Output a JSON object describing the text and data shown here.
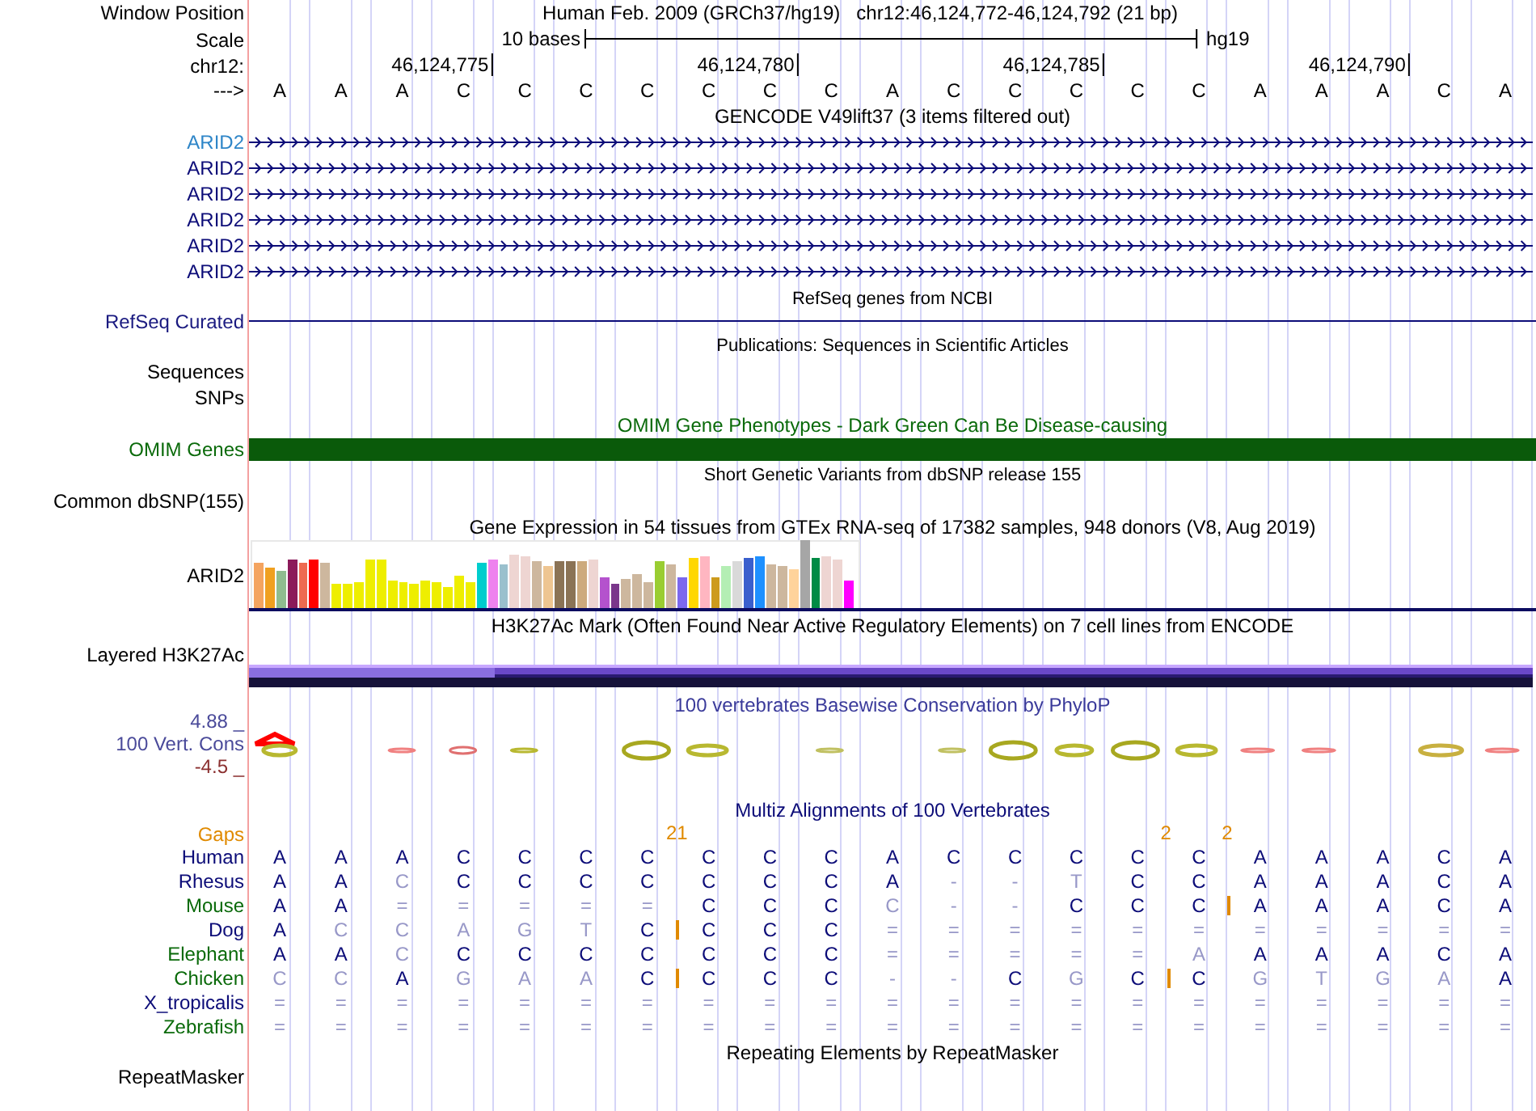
{
  "position": {
    "label": "Window Position",
    "assembly": "Human Feb. 2009 (GRCh37/hg19)",
    "range": "chr12:46,124,772-46,124,792 (21 bp)"
  },
  "scale": {
    "label": "Scale",
    "span": "10 bases",
    "assembly": "hg19"
  },
  "ruler": {
    "label": "chr12:",
    "ticks": [
      "46,124,775",
      "46,124,780",
      "46,124,785",
      "46,124,790"
    ]
  },
  "sequence": {
    "label": "--->",
    "bases": [
      "A",
      "A",
      "A",
      "C",
      "C",
      "C",
      "C",
      "C",
      "C",
      "C",
      "A",
      "C",
      "C",
      "C",
      "C",
      "C",
      "A",
      "A",
      "A",
      "C",
      "A"
    ]
  },
  "tracks": [
    {
      "kind": "gene",
      "title": "GENCODE V49lift37 (3 items filtered out)",
      "items": [
        {
          "name": "ARID2",
          "color": "#2f86c8"
        },
        {
          "name": "ARID2",
          "color": "#0c0c78"
        },
        {
          "name": "ARID2",
          "color": "#0c0c78"
        },
        {
          "name": "ARID2",
          "color": "#0c0c78"
        },
        {
          "name": "ARID2",
          "color": "#0c0c78"
        },
        {
          "name": "ARID2",
          "color": "#0c0c78"
        }
      ]
    },
    {
      "kind": "line",
      "title": "RefSeq genes from NCBI",
      "label": "RefSeq Curated"
    },
    {
      "kind": "labels",
      "title": "Publications: Sequences in Scientific Articles",
      "labels": [
        "Sequences",
        "SNPs"
      ]
    },
    {
      "kind": "bar",
      "title": "OMIM Gene Phenotypes - Dark Green Can Be Disease-causing",
      "label": "OMIM Genes"
    },
    {
      "kind": "labels",
      "title": "Short Genetic Variants from dbSNP release 155",
      "labels": [
        "Common dbSNP(155)"
      ]
    },
    {
      "kind": "expression",
      "title": "Gene Expression in 54 tissues from GTEx RNA-seq of 17382 samples, 948 donors (V8, Aug 2019)",
      "label": "ARID2"
    },
    {
      "kind": "signal",
      "title": "H3K27Ac Mark (Often Found Near Active Regulatory Elements) on 7 cell lines from ENCODE",
      "label": "Layered H3K27Ac"
    },
    {
      "kind": "conservation",
      "title": "100 vertebrates Basewise Conservation by PhyloP",
      "label": "100 Vert. Cons",
      "max": "4.88 _",
      "min": "-4.5 _"
    },
    {
      "kind": "alignment",
      "title": "Multiz Alignments of 100 Vertebrates",
      "gaps_label": "Gaps",
      "gaps": [
        {
          "count": "21"
        },
        {
          "count": "2"
        },
        {
          "count": "2"
        }
      ],
      "species": [
        {
          "name": "Human",
          "color": "#0c0c78",
          "bases": [
            "A",
            "A",
            "A",
            "C",
            "C",
            "C",
            "C",
            "C",
            "C",
            "C",
            "A",
            "C",
            "C",
            "C",
            "C",
            "C",
            "A",
            "A",
            "A",
            "C",
            "A"
          ],
          "faded": [
            false,
            false,
            false,
            false,
            false,
            false,
            false,
            false,
            false,
            false,
            false,
            false,
            false,
            false,
            false,
            false,
            false,
            false,
            false,
            false,
            false
          ],
          "insert_before": [
            false,
            false,
            false,
            false,
            false,
            false,
            false,
            false,
            false,
            false,
            false,
            false,
            false,
            false,
            false,
            false,
            false,
            false,
            false,
            false,
            false
          ]
        },
        {
          "name": "Rhesus",
          "color": "#0c0c78",
          "bases": [
            "A",
            "A",
            "C",
            "C",
            "C",
            "C",
            "C",
            "C",
            "C",
            "C",
            "A",
            "-",
            "-",
            "T",
            "C",
            "C",
            "A",
            "A",
            "A",
            "C",
            "A"
          ],
          "faded": [
            false,
            false,
            true,
            false,
            false,
            false,
            false,
            false,
            false,
            false,
            false,
            true,
            true,
            true,
            false,
            false,
            false,
            false,
            false,
            false,
            false
          ],
          "insert_before": [
            false,
            false,
            false,
            false,
            false,
            false,
            false,
            false,
            false,
            false,
            false,
            false,
            false,
            false,
            false,
            false,
            false,
            false,
            false,
            false,
            false
          ]
        },
        {
          "name": "Mouse",
          "color": "#0a6a0a",
          "bases": [
            "A",
            "A",
            "=",
            "=",
            "=",
            "=",
            "=",
            "C",
            "C",
            "C",
            "C",
            "-",
            "-",
            "C",
            "C",
            "C",
            "A",
            "A",
            "A",
            "C",
            "A"
          ],
          "faded": [
            false,
            false,
            true,
            true,
            true,
            true,
            true,
            false,
            false,
            false,
            true,
            true,
            true,
            false,
            false,
            false,
            false,
            false,
            false,
            false,
            false
          ],
          "insert_before": [
            false,
            false,
            false,
            false,
            false,
            false,
            false,
            false,
            false,
            false,
            false,
            false,
            false,
            false,
            false,
            false,
            true,
            false,
            false,
            false,
            false
          ]
        },
        {
          "name": "Dog",
          "color": "#0c0c78",
          "bases": [
            "A",
            "C",
            "C",
            "A",
            "G",
            "T",
            "C",
            "C",
            "C",
            "C",
            "=",
            "=",
            "=",
            "=",
            "=",
            "=",
            "=",
            "=",
            "=",
            "=",
            "="
          ],
          "faded": [
            false,
            true,
            true,
            true,
            true,
            true,
            false,
            false,
            false,
            false,
            true,
            true,
            true,
            true,
            true,
            true,
            true,
            true,
            true,
            true,
            true
          ],
          "insert_before": [
            false,
            false,
            false,
            false,
            false,
            false,
            false,
            true,
            false,
            false,
            false,
            false,
            false,
            false,
            false,
            false,
            false,
            false,
            false,
            false,
            false
          ]
        },
        {
          "name": "Elephant",
          "color": "#0a6a0a",
          "bases": [
            "A",
            "A",
            "C",
            "C",
            "C",
            "C",
            "C",
            "C",
            "C",
            "C",
            "=",
            "=",
            "=",
            "=",
            "=",
            "A",
            "A",
            "A",
            "A",
            "C",
            "A"
          ],
          "faded": [
            false,
            false,
            true,
            false,
            false,
            false,
            false,
            false,
            false,
            false,
            true,
            true,
            true,
            true,
            true,
            true,
            false,
            false,
            false,
            false,
            false
          ],
          "insert_before": [
            false,
            false,
            false,
            false,
            false,
            false,
            false,
            false,
            false,
            false,
            false,
            false,
            false,
            false,
            false,
            false,
            false,
            false,
            false,
            false,
            false
          ]
        },
        {
          "name": "Chicken",
          "color": "#0a6a0a",
          "bases": [
            "C",
            "C",
            "A",
            "G",
            "A",
            "A",
            "C",
            "C",
            "C",
            "C",
            "-",
            "-",
            "C",
            "G",
            "C",
            "C",
            "G",
            "T",
            "G",
            "A",
            "A"
          ],
          "faded": [
            true,
            true,
            false,
            true,
            true,
            true,
            false,
            false,
            false,
            false,
            true,
            true,
            false,
            true,
            false,
            false,
            true,
            true,
            true,
            true,
            false
          ],
          "insert_before": [
            false,
            false,
            false,
            false,
            false,
            false,
            false,
            true,
            false,
            false,
            false,
            false,
            false,
            false,
            false,
            true,
            false,
            false,
            false,
            false,
            false
          ]
        },
        {
          "name": "X_tropicalis",
          "color": "#0c0c78",
          "bases": [
            "=",
            "=",
            "=",
            "=",
            "=",
            "=",
            "=",
            "=",
            "=",
            "=",
            "=",
            "=",
            "=",
            "=",
            "=",
            "=",
            "=",
            "=",
            "=",
            "=",
            "="
          ],
          "faded": [
            true,
            true,
            true,
            true,
            true,
            true,
            true,
            true,
            true,
            true,
            true,
            true,
            true,
            true,
            true,
            true,
            true,
            true,
            true,
            true,
            true
          ],
          "insert_before": [
            false,
            false,
            false,
            false,
            false,
            false,
            false,
            false,
            false,
            false,
            false,
            false,
            false,
            false,
            false,
            false,
            false,
            false,
            false,
            false,
            false
          ]
        },
        {
          "name": "Zebrafish",
          "color": "#0a6a0a",
          "bases": [
            "=",
            "=",
            "=",
            "=",
            "=",
            "=",
            "=",
            "=",
            "=",
            "=",
            "=",
            "=",
            "=",
            "=",
            "=",
            "=",
            "=",
            "=",
            "=",
            "=",
            "="
          ],
          "faded": [
            true,
            true,
            true,
            true,
            true,
            true,
            true,
            true,
            true,
            true,
            true,
            true,
            true,
            true,
            true,
            true,
            true,
            true,
            true,
            true,
            true
          ],
          "insert_before": [
            false,
            false,
            false,
            false,
            false,
            false,
            false,
            false,
            false,
            false,
            false,
            false,
            false,
            false,
            false,
            false,
            false,
            false,
            false,
            false,
            false
          ]
        }
      ]
    },
    {
      "kind": "repeat",
      "title": "Repeating Elements by RepeatMasker",
      "label": "RepeatMasker"
    }
  ]
}
